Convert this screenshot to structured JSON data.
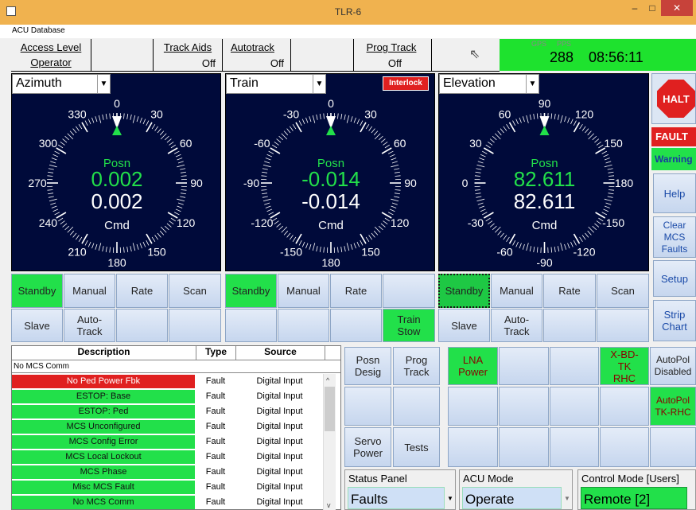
{
  "window": {
    "title": "TLR-6",
    "minimize": "–",
    "maximize": "□",
    "close": "✕"
  },
  "menu": {
    "label": "ACU Database"
  },
  "toolbar": [
    {
      "label": "Access Level",
      "value": "Operator"
    },
    {
      "label": "Track Aids",
      "value": "Off"
    },
    {
      "label": "Autotrack",
      "value": "Off"
    },
    {
      "label": "Prog Track",
      "value": "Off"
    }
  ],
  "gps": {
    "gps_label": "GPS",
    "pps_label": "PPS",
    "day": "288",
    "time": "08:56:11"
  },
  "dials": [
    {
      "axis": "Azimuth",
      "posn_label": "Posn",
      "posn": "0.002",
      "cmd": "0.002",
      "cmd_label": "Cmd",
      "ticks": [
        "0",
        "30",
        "60",
        "90",
        "120",
        "150",
        "180",
        "210",
        "240",
        "270",
        "300",
        "330"
      ]
    },
    {
      "axis": "Train",
      "posn_label": "Posn",
      "posn": "-0.014",
      "cmd": "-0.014",
      "cmd_label": "Cmd",
      "interlock": "Interlock",
      "ticks": [
        "0",
        "30",
        "60",
        "90",
        "120",
        "150",
        "180",
        "-150",
        "-120",
        "-90",
        "-60",
        "-30"
      ]
    },
    {
      "axis": "Elevation",
      "posn_label": "Posn",
      "posn": "82.611",
      "cmd": "82.611",
      "cmd_label": "Cmd",
      "ticks": [
        "90",
        "120",
        "150",
        "180",
        "-150",
        "-120",
        "-90",
        "-60",
        "-30",
        "0",
        "30",
        "60"
      ]
    }
  ],
  "mode_buttons": {
    "az_row1": [
      "Standby",
      "Manual",
      "Rate",
      "Scan"
    ],
    "az_row2": [
      "Slave",
      "Auto-Track"
    ],
    "tr_row1": [
      "Standby",
      "Manual",
      "Rate"
    ],
    "tr_row2": [
      "Train Stow"
    ],
    "el_row1": [
      "Standby",
      "Manual",
      "Rate",
      "Scan"
    ],
    "el_row2": [
      "Slave",
      "Auto-Track"
    ]
  },
  "side": {
    "halt": "HALT",
    "fault": "FAULT",
    "warning": "Warning",
    "help": "Help",
    "clear": "Clear MCS Faults",
    "setup": "Setup",
    "strip": "Strip Chart"
  },
  "faults_table": {
    "headers": [
      "Description",
      "Type",
      "Source"
    ],
    "banner": "No MCS Comm",
    "rows": [
      {
        "description": "No Ped Power Fbk",
        "type": "Fault",
        "source": "Digital Input",
        "severity": "red"
      },
      {
        "description": "ESTOP: Base",
        "type": "Fault",
        "source": "Digital Input",
        "severity": "green"
      },
      {
        "description": "ESTOP: Ped",
        "type": "Fault",
        "source": "Digital Input",
        "severity": "green"
      },
      {
        "description": "MCS Unconfigured",
        "type": "Fault",
        "source": "Digital Input",
        "severity": "green"
      },
      {
        "description": "MCS Config Error",
        "type": "Fault",
        "source": "Digital Input",
        "severity": "green"
      },
      {
        "description": "MCS Local Lockout",
        "type": "Fault",
        "source": "Digital Input",
        "severity": "green"
      },
      {
        "description": "MCS Phase",
        "type": "Fault",
        "source": "Digital Input",
        "severity": "green"
      },
      {
        "description": "Misc MCS Fault",
        "type": "Fault",
        "source": "Digital Input",
        "severity": "green"
      },
      {
        "description": "No MCS Comm",
        "type": "Fault",
        "source": "Digital Input",
        "severity": "green"
      }
    ]
  },
  "func_buttons": {
    "posn_desig": "Posn Desig",
    "prog_track": "Prog Track",
    "servo_power": "Servo Power",
    "tests": "Tests"
  },
  "rf_buttons": {
    "lna_power": "LNA Power",
    "xbd": "X-BD-TK RHC",
    "autopol_disabled": "AutoPol Disabled",
    "autopol_tk": "AutoPol TK-RHC"
  },
  "bottom": {
    "status_panel": {
      "label": "Status Panel",
      "value": "Faults"
    },
    "acu_mode": {
      "label": "ACU Mode",
      "value": "Operate"
    },
    "control_mode": {
      "label": "Control Mode [Users]",
      "value": "Remote [2]"
    }
  },
  "colors": {
    "dial_bg": "#000a3a",
    "active_green": "#22e04a",
    "fault_red": "#e02020",
    "titlebar": "#f0b24f"
  }
}
